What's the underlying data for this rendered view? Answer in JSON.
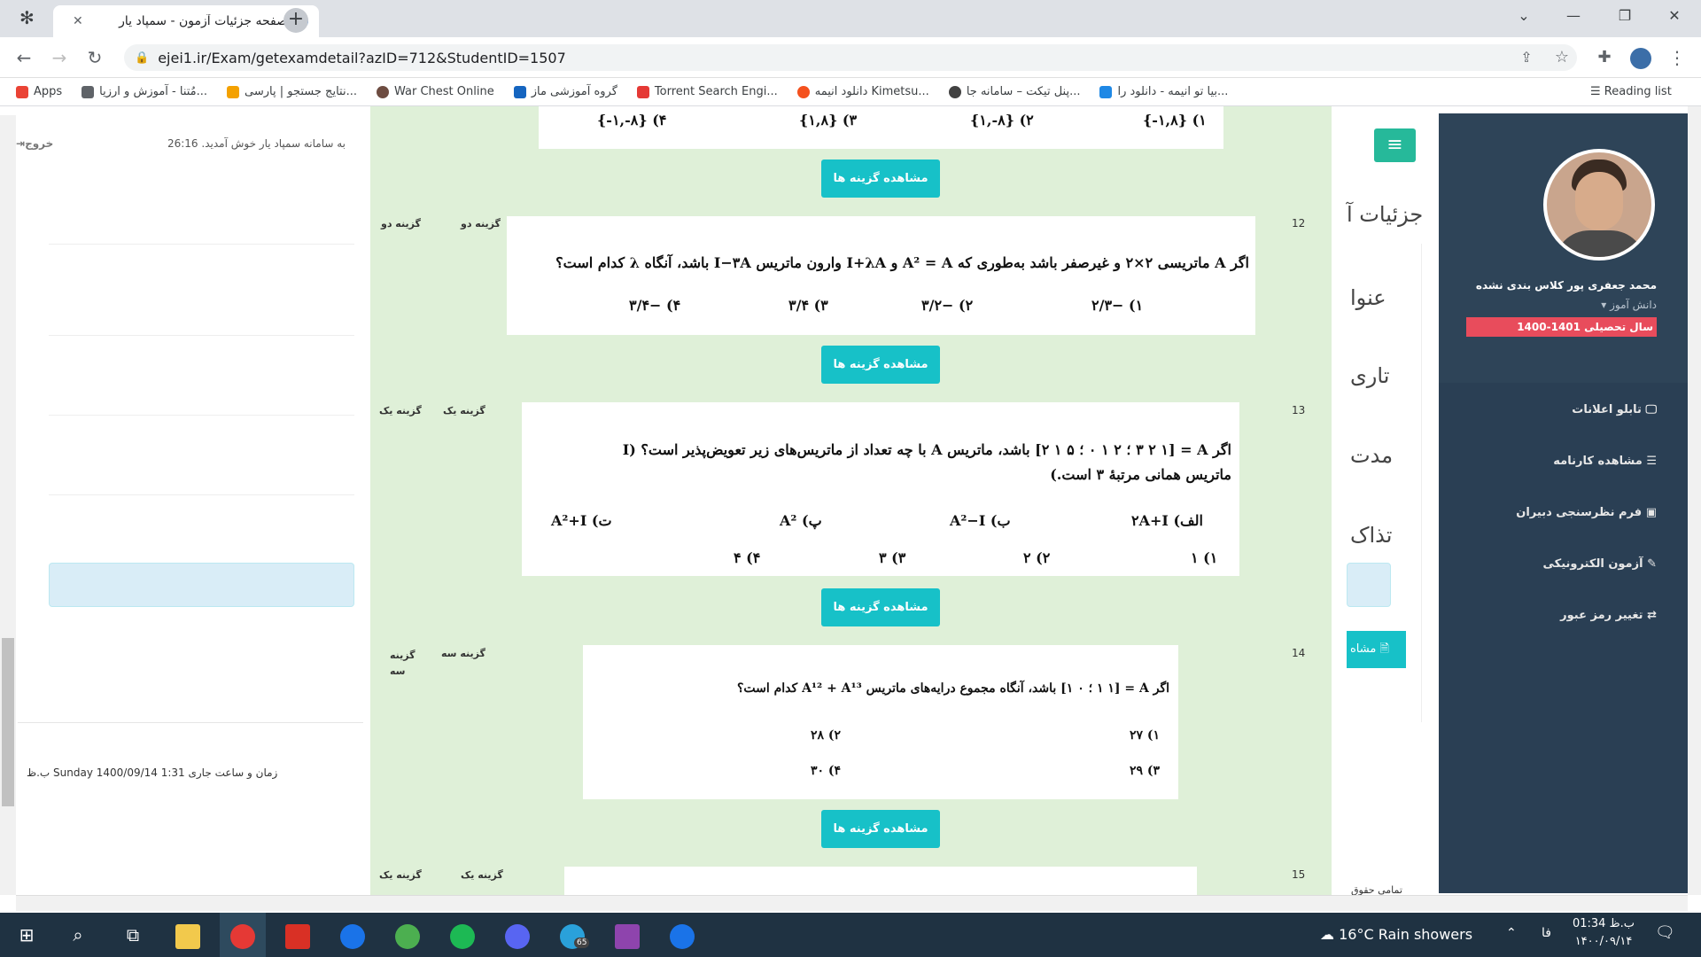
{
  "browser": {
    "tab_title": "صفحه جزئیات آزمون - سمپاد یار",
    "tab_close": "✕",
    "new_tab": "+",
    "url": "ejei1.ir/Exam/getexamdetail?azID=712&StudentID=1507",
    "bookmarks": [
      {
        "label": "Apps",
        "color": "#ea4335"
      },
      {
        "label": "مُتنا - آموزش و ارزیا...",
        "color": "#5f6368"
      },
      {
        "label": "نتایج جستجو | پارسی...",
        "color": "#f4a100"
      },
      {
        "label": "War Chest Online",
        "color": "#6d4c41"
      },
      {
        "label": "گروه آموزشی ماز",
        "color": "#1565c0"
      },
      {
        "label": "Torrent Search Engi...",
        "color": "#e53935"
      },
      {
        "label": "دانلود انیمه Kimetsu...",
        "color": "#f4511e"
      },
      {
        "label": "پنل تیکت – سامانه جا...",
        "color": "#424242"
      },
      {
        "label": "بیا تو انیمه - دانلود را...",
        "color": "#1e88e5"
      }
    ],
    "reading_list": "Reading list"
  },
  "page": {
    "welcome": "به سامانه سمپاد یار خوش آمدید. 26:16",
    "logout": "خروج",
    "datetime": "زمان و ساعت جاری Sunday 1400/09/14 1:31 ب.ظ",
    "bg_title": "جزئیات آ",
    "bg_labels": [
      "عنوا",
      "تاری",
      "مدت",
      "تذاک"
    ],
    "bg_button": "مشاه",
    "footer_partial": "تمامی حقوق"
  },
  "modal": {
    "view_options_label": "مشاهده گزینه ها",
    "top_options": [
      "۱) {۱,۸-}",
      "۲) {۸-,۱}",
      "۳) {۱,۸}",
      "۴) {۸-,۱-}"
    ],
    "questions": [
      {
        "number": "12",
        "answer1": "گزینه دو",
        "answer2": "گزینه دو",
        "text": "اگر A ماتریسی ۲×۲ و غیرصفر باشد به‌طوری که A² = A و I+λA وارون ماتریس I−۳A باشد، آنگاه λ کدام است؟",
        "options": [
          "۱) −۲/۳",
          "۲) −۳/۲",
          "۳) ۳/۴",
          "۴) −۳/۴"
        ]
      },
      {
        "number": "13",
        "answer1": "گزینه یک",
        "answer2": "گزینه یک",
        "text": "اگر A = [۳ ۲ ۱ ؛ ۲ ۱ ۰ ؛ ۵ ۱ ۲] باشد، ماتریس A با چه تعداد از ماتریس‌های زیر تعویض‌پذیر است؟ (I ماتریس همانی مرتبهٔ ۳ است.)",
        "sub": [
          "الف) ۲A+I",
          "ب) A²−I",
          "پ) A²",
          "ت) A²+I"
        ],
        "options": [
          "۱) ۱",
          "۲) ۲",
          "۳) ۳",
          "۴) ۴"
        ]
      },
      {
        "number": "14",
        "answer1": "گزینه سه",
        "answer2": "گزینه سه",
        "text": "اگر A = [۱ ۱ ؛ ۰ ۱] باشد، آنگاه مجموع درایه‌های ماتریس A¹² + A¹³ کدام است؟",
        "options": [
          "۱) ۲۷",
          "۲) ۲۸",
          "۳) ۲۹",
          "۴) ۳۰"
        ]
      },
      {
        "number": "15",
        "answer1": "گزینه یک",
        "answer2": "گزینه یک"
      }
    ]
  },
  "sidebar": {
    "user_name": "محمد جعفری پور کلاس بندی نشده",
    "role": "دانش آموز",
    "year": "سال تحصیلی 1401-1400",
    "menu": [
      {
        "label": "تابلو اعلانات",
        "icon": "monitor-icon"
      },
      {
        "label": "مشاهده کارنامه",
        "icon": "list-icon"
      },
      {
        "label": "فرم نظرسنجی دبیران",
        "icon": "id-card-icon"
      },
      {
        "label": "آزمون الکترونیکی",
        "icon": "edit-icon"
      },
      {
        "label": "تغییر رمز عبور",
        "icon": "exchange-icon"
      }
    ]
  },
  "taskbar": {
    "weather": "16°C  Rain showers",
    "lang": "فا",
    "time": "01:34 ب.ظ",
    "date": "۱۴۰۰/۰۹/۱۴",
    "badge": "65"
  }
}
